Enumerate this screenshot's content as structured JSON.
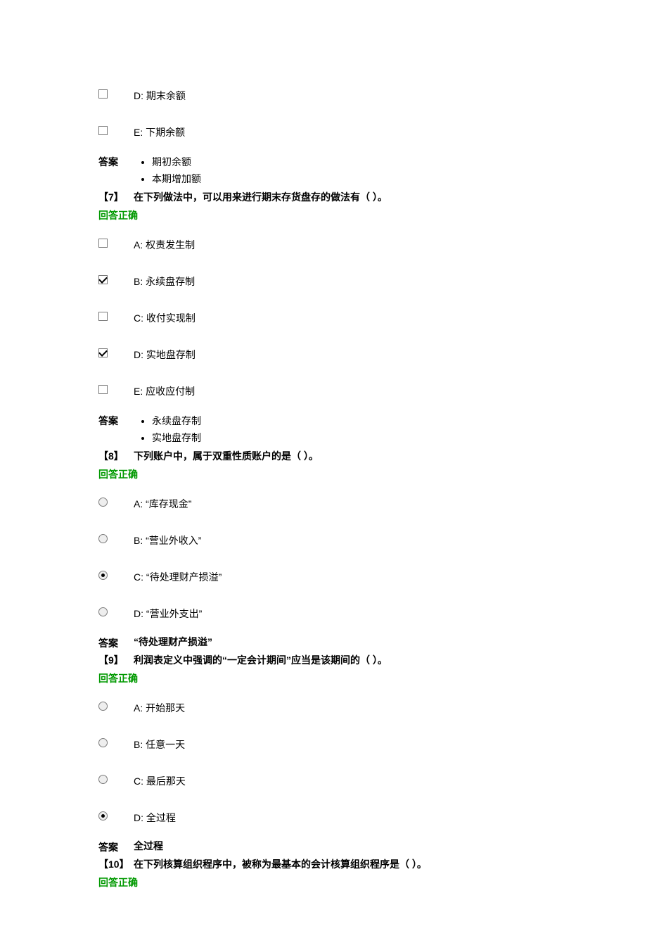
{
  "labels": {
    "answer": "答案",
    "correct": "回答正确"
  },
  "pre_options": [
    {
      "letter": "D",
      "text": "期末余额",
      "checked": false
    },
    {
      "letter": "E",
      "text": "下期余额",
      "checked": false
    }
  ],
  "pre_answer": [
    "期初余额",
    "本期增加额"
  ],
  "questions": [
    {
      "num": "【7】",
      "text": "在下列做法中，可以用来进行期末存货盘存的做法有（ ）。",
      "type": "checkbox",
      "options": [
        {
          "letter": "A",
          "text": "权责发生制",
          "checked": false
        },
        {
          "letter": "B",
          "text": "永续盘存制",
          "checked": true
        },
        {
          "letter": "C",
          "text": "收付实现制",
          "checked": false
        },
        {
          "letter": "D",
          "text": "实地盘存制",
          "checked": true
        },
        {
          "letter": "E",
          "text": "应收应付制",
          "checked": false
        }
      ],
      "answer_list": [
        "永续盘存制",
        "实地盘存制"
      ]
    },
    {
      "num": "【8】",
      "text": "下列账户中，属于双重性质账户的是（ ）。",
      "type": "radio",
      "options": [
        {
          "letter": "A",
          "text": "“库存现金”",
          "checked": false
        },
        {
          "letter": "B",
          "text": "“营业外收入”",
          "checked": false
        },
        {
          "letter": "C",
          "text": "“待处理财产损溢”",
          "checked": true
        },
        {
          "letter": "D",
          "text": "“营业外支出”",
          "checked": false
        }
      ],
      "answer_single": "“待处理财产损溢”"
    },
    {
      "num": "【9】",
      "text": "利润表定义中强调的“一定会计期间”应当是该期间的（ ）。",
      "type": "radio",
      "options": [
        {
          "letter": "A",
          "text": "开始那天",
          "checked": false
        },
        {
          "letter": "B",
          "text": "任意一天",
          "checked": false
        },
        {
          "letter": "C",
          "text": "最后那天",
          "checked": false
        },
        {
          "letter": "D",
          "text": "全过程",
          "checked": true
        }
      ],
      "answer_single": "全过程"
    },
    {
      "num": "【10】",
      "text": "在下列核算组织程序中，被称为最基本的会计核算组织程序是（ ）。",
      "type": "radio",
      "no_options_shown": true
    }
  ]
}
